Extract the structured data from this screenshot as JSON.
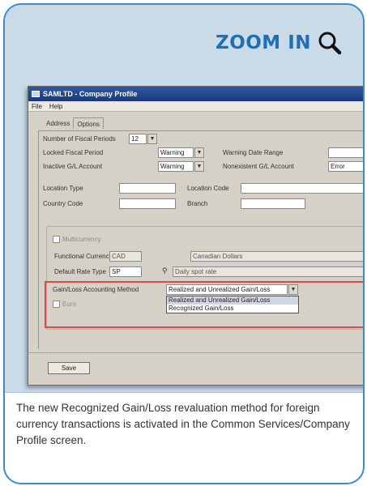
{
  "header": {
    "zoom_label": "ZOOM IN",
    "zoom_icon": "magnifier-icon"
  },
  "window": {
    "title": "SAMLTD - Company Profile",
    "menu": [
      "File",
      "Help"
    ],
    "tabs": [
      "Address",
      "Options"
    ],
    "fields": {
      "fiscal_periods_label": "Number of Fiscal Periods",
      "fiscal_periods_value": "12",
      "locked_period_label": "Locked Fiscal Period",
      "locked_period_value": "Warning",
      "warning_range_label": "Warning Date Range",
      "inactive_gl_label": "Inactive G/L Account",
      "inactive_gl_value": "Warning",
      "nonexistent_gl_label": "Nonexistent G/L Account",
      "nonexistent_gl_value": "Error",
      "location_type_label": "Location Type",
      "location_code_label": "Location Code",
      "country_code_label": "Country Code",
      "branch_label": "Branch",
      "multicurrency_label": "Multicurrency",
      "functional_currency_label": "Functional Currency",
      "functional_currency_value": "CAD",
      "functional_currency_desc": "Canadian Dollars",
      "rate_type_label": "Default Rate Type",
      "rate_type_value": "SP",
      "rate_type_desc": "Daily spot rate",
      "gain_loss_label": "Gain/Loss Accounting Method",
      "gain_loss_value": "Realized and Unrealized Gain/Loss",
      "gain_loss_options": [
        "Realized and Unrealized Gain/Loss",
        "Recognized Gain/Loss"
      ],
      "euro_label": "Euro"
    },
    "save_label": "Save"
  },
  "caption": "The new Recognized Gain/Loss revaluation method for foreign currency transactions is activated in the Common Services/Company Profile screen.",
  "colors": {
    "accent": "#1f6fb4",
    "border": "#3a8ec8",
    "highlight": "#d94a48",
    "panel": "#c9dbe9"
  }
}
